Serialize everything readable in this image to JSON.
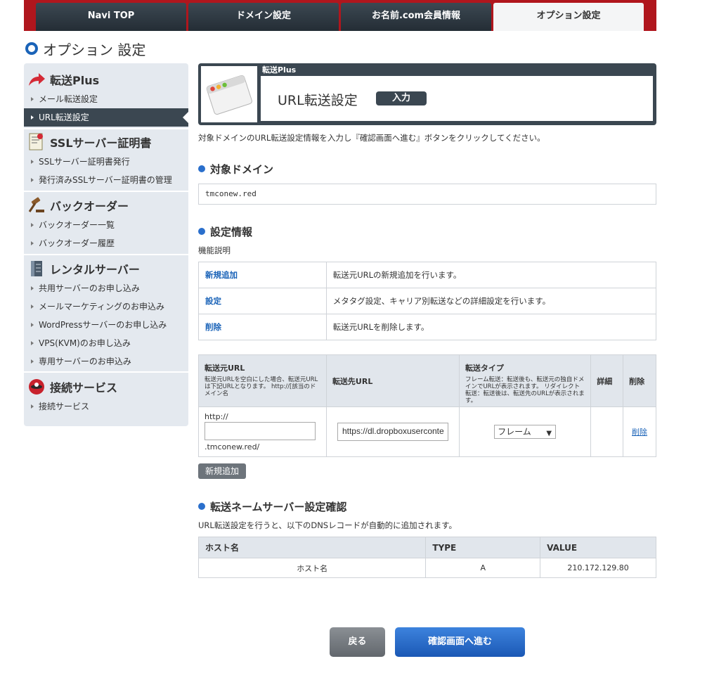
{
  "nav": {
    "tabs": [
      {
        "label": "Navi TOP"
      },
      {
        "label": "ドメイン設定"
      },
      {
        "label": "お名前.com会員情報"
      },
      {
        "label": "オプション設定"
      }
    ]
  },
  "page_title": "オプション 設定",
  "sidebar": {
    "groups": [
      {
        "title": "転送Plus",
        "icon": "redirect-arrow-icon",
        "items": [
          "メール転送設定",
          "URL転送設定"
        ]
      },
      {
        "title": "SSLサーバー証明書",
        "icon": "certificate-icon",
        "items": [
          "SSLサーバー証明書発行",
          "発行済みSSLサーバー証明書の管理"
        ]
      },
      {
        "title": "バックオーダー",
        "icon": "gavel-icon",
        "items": [
          "バックオーダー一覧",
          "バックオーダー履歴"
        ]
      },
      {
        "title": "レンタルサーバー",
        "icon": "server-icon",
        "items": [
          "共用サーバーのお申し込み",
          "メールマーケティングのお申込み",
          "WordPressサーバーのお申し込み",
          "VPS(KVM)のお申し込み",
          "専用サーバーのお申込み"
        ]
      },
      {
        "title": "接続サービス",
        "icon": "connection-icon",
        "items": [
          "接続サービス"
        ]
      }
    ]
  },
  "header": {
    "kicker": "転送Plus",
    "title": "URL転送設定",
    "badge": "入力"
  },
  "description": "対象ドメインのURL転送設定情報を入力し『確認画面へ進む』ボタンをクリックしてください。",
  "domain_section": {
    "title": "対象ドメイン",
    "value": "tmconew.red"
  },
  "settings_section": {
    "title": "設定情報",
    "subtitle": "機能説明",
    "functions": [
      {
        "key": "新規追加",
        "desc": "転送元URLの新規追加を行います。"
      },
      {
        "key": "設定",
        "desc": "メタタグ設定、キャリア別転送などの詳細設定を行います。"
      },
      {
        "key": "削除",
        "desc": "転送元URLを削除します。"
      }
    ]
  },
  "rules_table": {
    "headers": {
      "source": "転送元URL",
      "source_note": "転送元URLを空白にした場合、転送元URLは下記URLとなります。 http://[該当のドメイン名",
      "dest": "転送先URL",
      "type": "転送タイプ",
      "type_note": "フレーム転送：転送後も、転送元の独自ドメインでURLが表示されます。 リダイレクト転送：転送後は、転送先のURLが表示されます。",
      "detail": "詳細",
      "delete": "削除"
    },
    "row": {
      "prefix": "http://",
      "source_value": "",
      "suffix": ".tmconew.red/",
      "dest_value": "https://dl.dropboxuserconte",
      "type_value": "フレーム",
      "delete_link": "削除"
    }
  },
  "add_button": "新規追加",
  "ns_section": {
    "title": "転送ネームサーバー設定確認",
    "note": "URL転送設定を行うと、以下のDNSレコードが自動的に追加されます。",
    "headers": [
      "ホスト名",
      "TYPE",
      "VALUE"
    ],
    "rows": [
      [
        "ホスト名",
        "A",
        "210.172.129.80"
      ]
    ]
  },
  "buttons": {
    "back": "戻る",
    "next": "確認画面へ進む"
  },
  "colors": {
    "brand_red": "#b0161d",
    "nav_dark": "#3b4751",
    "link_blue": "#1a63b8",
    "primary_button": "#1b58b5"
  }
}
